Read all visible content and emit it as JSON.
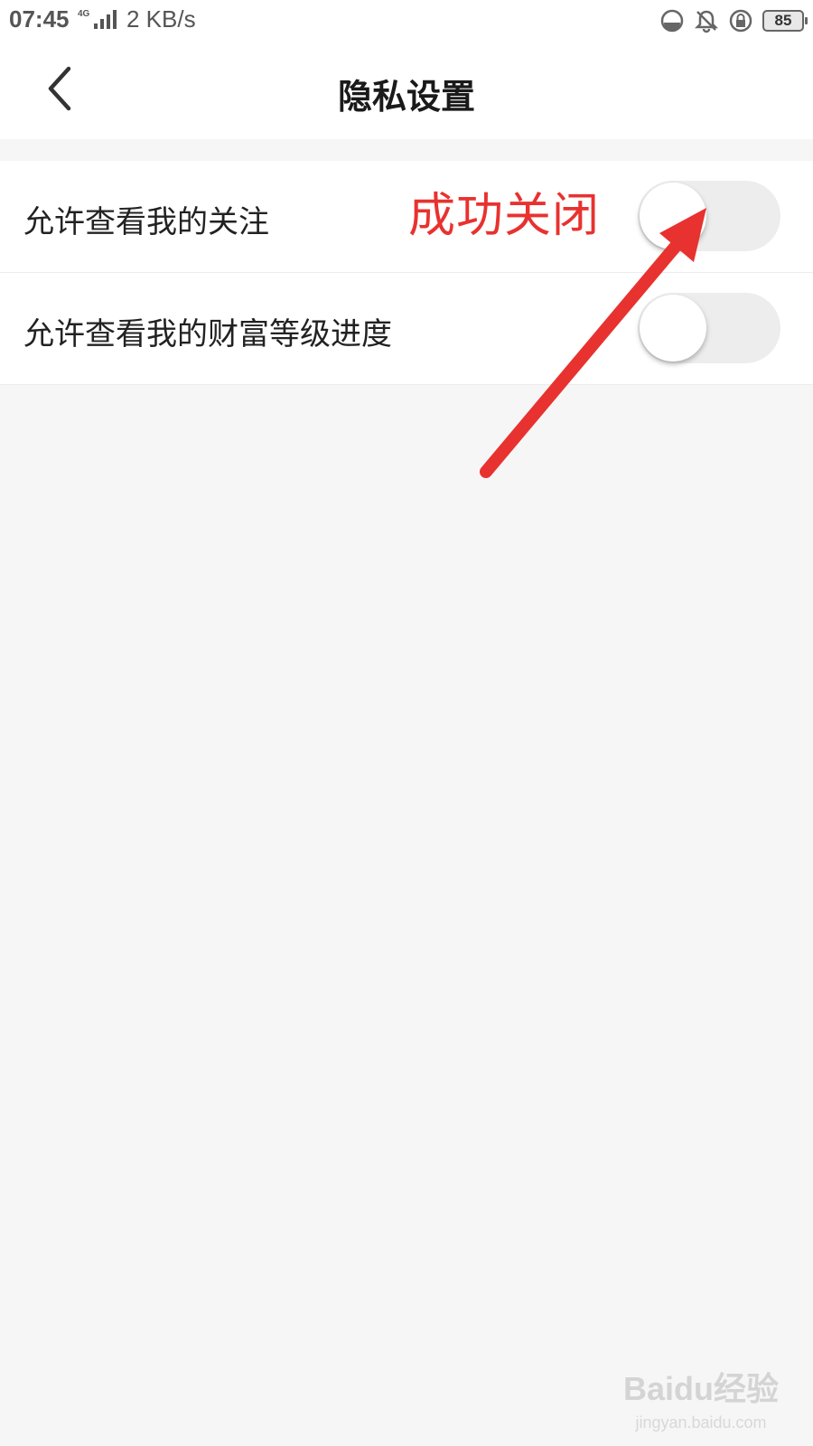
{
  "status_bar": {
    "time": "07:45",
    "network_type": "4G",
    "speed": "2 KB/s",
    "battery": "85",
    "icons": [
      "data-saver-icon",
      "bell-muted-icon",
      "rotation-lock-icon",
      "battery-icon"
    ]
  },
  "header": {
    "title": "隐私设置",
    "back_icon": "chevron-left-icon"
  },
  "settings": [
    {
      "label": "允许查看我的关注",
      "enabled": false
    },
    {
      "label": "允许查看我的财富等级进度",
      "enabled": false
    }
  ],
  "annotation": {
    "text": "成功关闭",
    "color": "#e8322f"
  },
  "watermark": {
    "logo": "Baidu经验",
    "url": "jingyan.baidu.com"
  },
  "colors": {
    "toggle_off_track": "#ededed",
    "page_background": "#f6f6f6"
  }
}
